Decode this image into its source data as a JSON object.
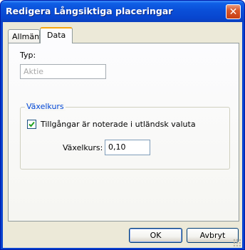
{
  "window": {
    "title": "Redigera Långsiktiga placeringar",
    "close_symbol": "✕"
  },
  "tabs": [
    {
      "label": "Allmänt",
      "active": false
    },
    {
      "label": "Data",
      "active": true
    }
  ],
  "form": {
    "type_label": "Typ:",
    "type_value": "Aktie",
    "group_title": "Växelkurs",
    "foreign_currency_checkbox": {
      "label": "Tillgångar är noterade i utländsk valuta",
      "checked": true
    },
    "rate_label": "Växelkurs:",
    "rate_value": "0,10"
  },
  "buttons": {
    "ok": "OK",
    "cancel": "Avbryt"
  },
  "colors": {
    "titlebar": "#0a4fd8",
    "group_title": "#0046d5",
    "active_tab_highlight": "#f7a60f",
    "dialog_background": "#ece9d8"
  },
  "icons": {
    "close": "close-icon",
    "check": "checkmark-icon",
    "resize": "resize-grip-icon"
  }
}
